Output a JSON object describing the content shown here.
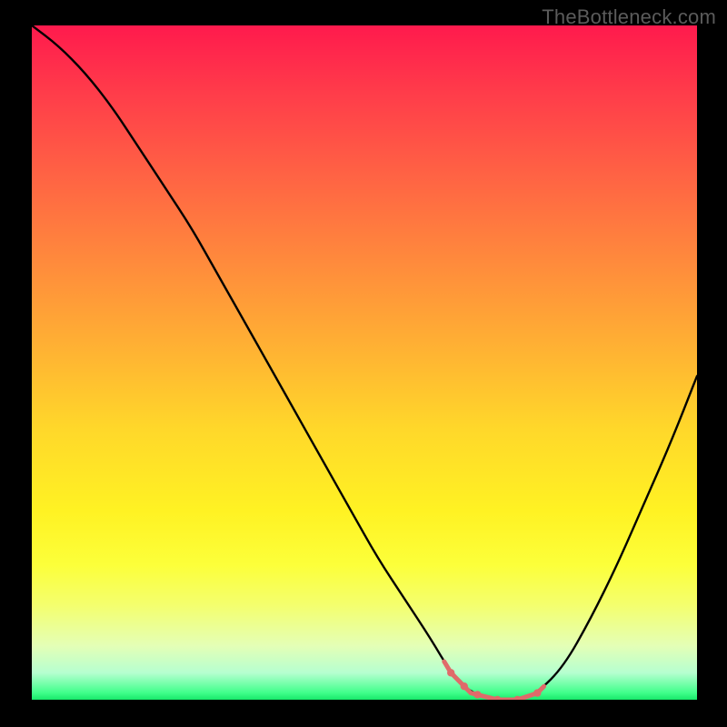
{
  "watermark": "TheBottleneck.com",
  "colors": {
    "background": "#000000",
    "curve": "#000000",
    "highlight": "#e06a6a",
    "watermark": "#5b5b5b"
  },
  "chart_data": {
    "type": "line",
    "title": "",
    "xlabel": "",
    "ylabel": "",
    "xlim": [
      0,
      100
    ],
    "ylim": [
      0,
      100
    ],
    "notes": "Values are estimated from visual position (no axes/ticks in source). y = approximate bottleneck (higher = worse). Minimum plateau around x≈63–76.",
    "series": [
      {
        "name": "bottleneck-curve",
        "x": [
          0,
          4,
          8,
          12,
          16,
          20,
          24,
          28,
          32,
          36,
          40,
          44,
          48,
          52,
          56,
          60,
          63,
          66,
          70,
          73,
          76,
          80,
          84,
          88,
          92,
          96,
          100
        ],
        "y": [
          100,
          97,
          93,
          88,
          82,
          76,
          70,
          63,
          56,
          49,
          42,
          35,
          28,
          21,
          15,
          9,
          4,
          1,
          0,
          0,
          1,
          5,
          12,
          20,
          29,
          38,
          48
        ]
      }
    ],
    "highlight_segment": {
      "description": "flattened bottom of curve drawn in muted red with dots",
      "x_range": [
        62,
        77
      ],
      "dot_x": [
        63,
        65,
        67,
        70,
        73,
        76
      ]
    }
  }
}
